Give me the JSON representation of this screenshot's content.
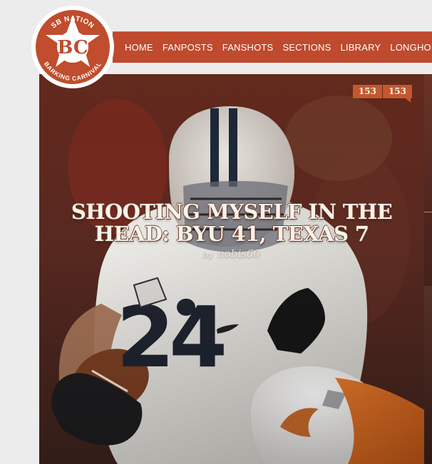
{
  "branding": {
    "network": "SB NATION",
    "initials": "BC",
    "site_name": "BARKING CARNIVAL",
    "accent_color": "#bf4a2d"
  },
  "nav": {
    "items": [
      {
        "label": "HOME"
      },
      {
        "label": "FANPOSTS"
      },
      {
        "label": "FANSHOTS"
      },
      {
        "label": "SECTIONS"
      },
      {
        "label": "LIBRARY"
      },
      {
        "label": "LONGHOR"
      }
    ]
  },
  "feature": {
    "comment_counts": [
      "153",
      "153"
    ],
    "headline": "SHOOTING MYSELF IN THE HEAD: BYU 41, TEXAS 7",
    "byline_prefix": "by",
    "author": "nobis60"
  }
}
